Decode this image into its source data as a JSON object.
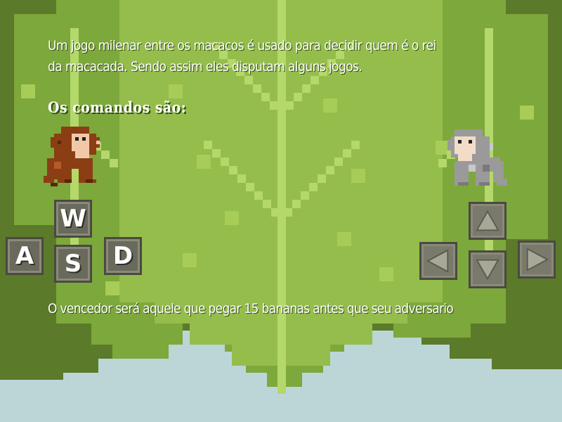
{
  "intro": {
    "line1": "Um jogo milenar entre os macacos é usado para decidir quem é o rei",
    "line2": "da macacada. Sendo assim eles disputam alguns jogos."
  },
  "commands_title": "Os comandos são:",
  "player1_keys": {
    "up": "W",
    "left": "A",
    "down": "S",
    "right": "D"
  },
  "player2_keys": {
    "up": "up-arrow-icon",
    "left": "left-arrow-icon",
    "down": "down-arrow-icon",
    "right": "right-arrow-icon"
  },
  "winner_text": "O vencedor será aquele que pegar 15 bananas antes que seu adversario",
  "colors": {
    "leaf_dark": "#5b7a2a",
    "leaf_mid": "#7da83c",
    "leaf_light": "#a7cc58",
    "sky": "#bcd6d8",
    "key_fill": "#6a6a5c",
    "brown_monkey": "#8b3e14",
    "gray_monkey": "#a8a8a8"
  }
}
